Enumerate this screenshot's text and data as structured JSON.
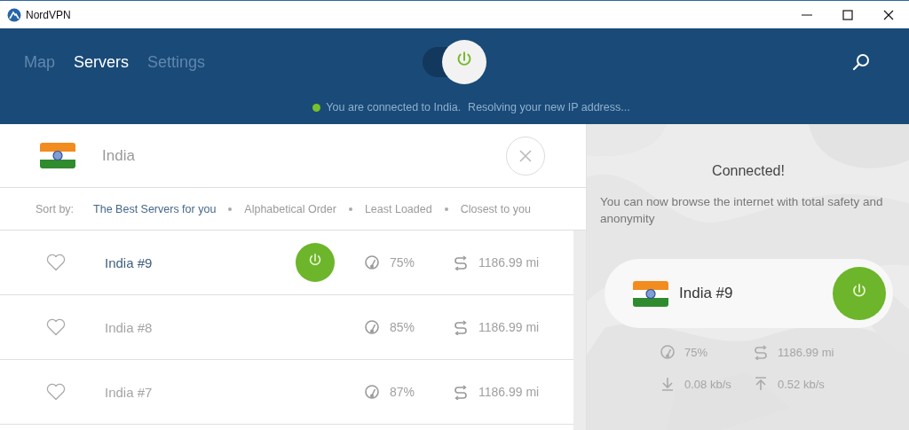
{
  "window": {
    "title": "NordVPN"
  },
  "tabs": [
    {
      "label": "Map",
      "selected": false
    },
    {
      "label": "Servers",
      "selected": true
    },
    {
      "label": "Settings",
      "selected": false
    }
  ],
  "connection_toggle": {
    "on": true
  },
  "status": {
    "connected": true,
    "text": "You are connected to India.",
    "detail": "Resolving your new IP address..."
  },
  "search": {
    "value": "India"
  },
  "sort": {
    "label": "Sort by:",
    "options": [
      {
        "label": "The Best Servers for you",
        "selected": true
      },
      {
        "label": "Alphabetical Order",
        "selected": false
      },
      {
        "label": "Least Loaded",
        "selected": false
      },
      {
        "label": "Closest to you",
        "selected": false
      }
    ]
  },
  "servers": [
    {
      "name": "India #9",
      "favorite": false,
      "connected": true,
      "load": "75%",
      "distance": "1186.99 mi"
    },
    {
      "name": "India #8",
      "favorite": false,
      "connected": false,
      "load": "85%",
      "distance": "1186.99 mi"
    },
    {
      "name": "India #7",
      "favorite": false,
      "connected": false,
      "load": "87%",
      "distance": "1186.99 mi"
    }
  ],
  "connected_panel": {
    "title": "Connected!",
    "message": "You can now browse the internet with total safety and anonymity",
    "server": "India #9",
    "load": "75%",
    "distance": "1186.99 mi",
    "download": "0.08 kb/s",
    "upload": "0.52 kb/s"
  }
}
